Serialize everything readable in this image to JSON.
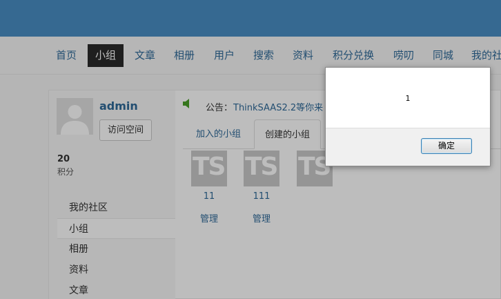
{
  "nav": {
    "items": [
      "首页",
      "小组",
      "文章",
      "相册",
      "用户",
      "搜索",
      "资料",
      "积分兑换",
      "唠叨",
      "同城",
      "我的社"
    ]
  },
  "profile": {
    "username": "admin",
    "visit_button": "访问空间",
    "points_value": "20",
    "points_label": "积分"
  },
  "sidebar": {
    "items": [
      "我的社区",
      "小组",
      "相册",
      "资料",
      "文章"
    ]
  },
  "notice": {
    "label": "公告：",
    "text": "ThinkSAAS2.2等你来"
  },
  "tabs": [
    "加入的小组",
    "创建的小组"
  ],
  "groups": [
    {
      "logo": "TS",
      "name": "11",
      "manage": "管理"
    },
    {
      "logo": "TS",
      "name": "111",
      "manage": "管理"
    },
    {
      "logo": "TS",
      "name": "",
      "manage": ""
    }
  ],
  "dialog": {
    "message": "1",
    "ok_label": "确定"
  },
  "colors": {
    "topbar": "#4a8ec4",
    "link": "#2f6a99",
    "nav_active_bg": "#2b2b2b"
  }
}
